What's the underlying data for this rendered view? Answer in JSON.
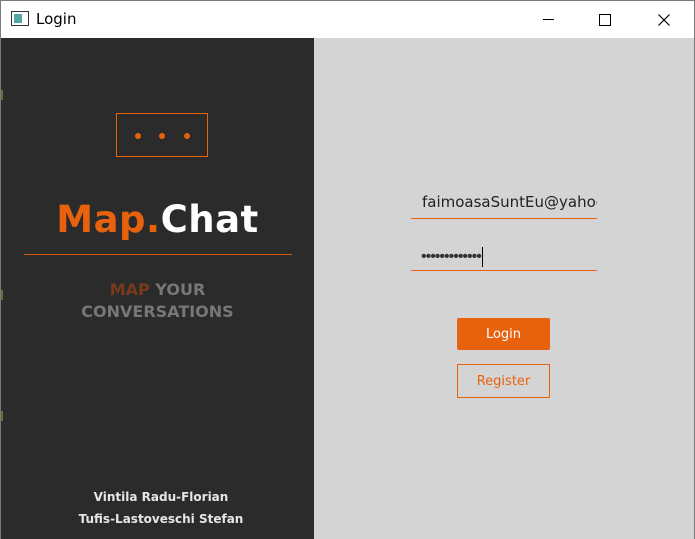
{
  "window": {
    "title": "Login",
    "icons": {
      "app": "window-app-icon",
      "minimize": "minimize-icon",
      "maximize": "maximize-icon",
      "close": "close-icon"
    },
    "close_glyph": "✕"
  },
  "branding": {
    "chat_icon": "chat-bubble-dots-icon",
    "brand_part1": "Map.",
    "brand_part2": "Chat",
    "tagline_accent": "MAP",
    "tagline_rest": "YOUR",
    "tagline_line2": "CONVERSATIONS",
    "author1": "Vintila Radu-Florian",
    "author2": "Tufis-Lastoveschi Stefan"
  },
  "form": {
    "email_value": "faimoasaSuntEu@yahoo.c",
    "password_masked": "•••••••••••••",
    "login_label": "Login",
    "register_label": "Register"
  },
  "colors": {
    "accent": "#e8620e",
    "left_panel_bg": "#2b2b2b",
    "right_panel_bg": "#d4d4d4"
  }
}
